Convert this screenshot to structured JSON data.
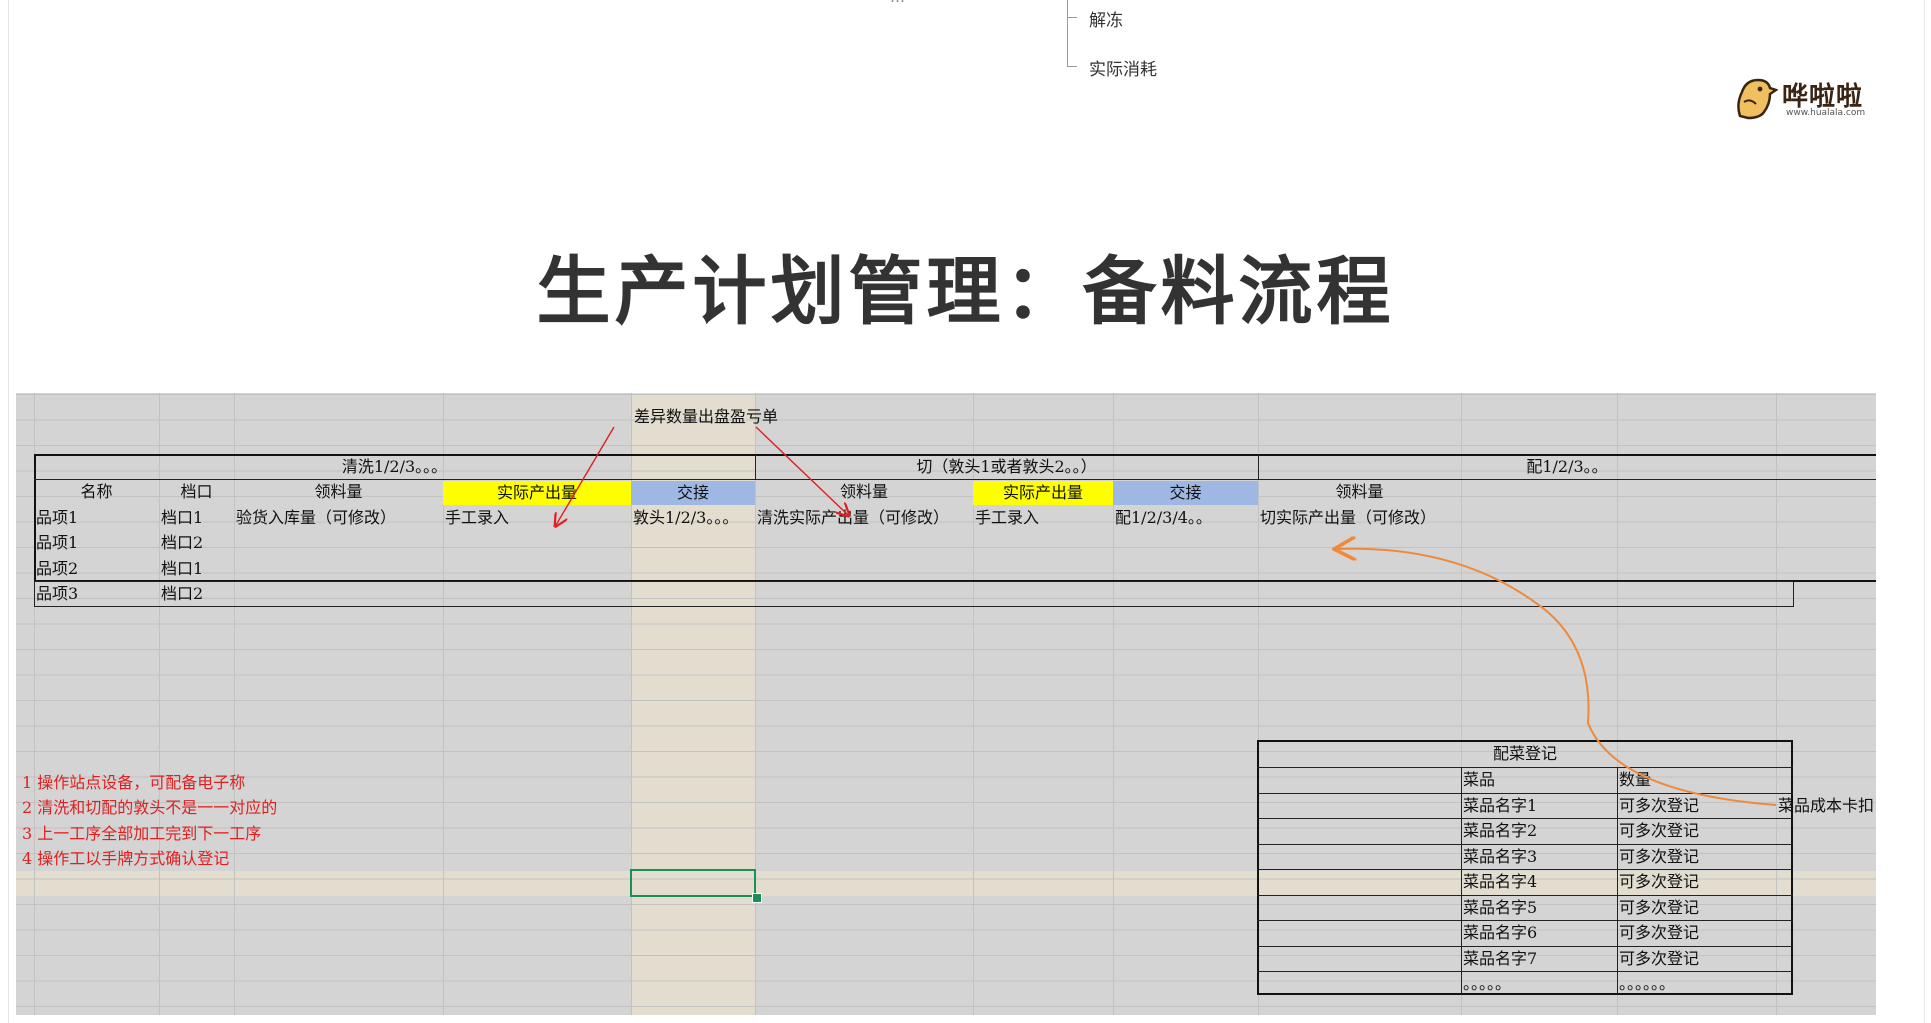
{
  "tree": {
    "cut_text": "…",
    "nodes": [
      "解冻",
      "实际消耗"
    ]
  },
  "logo": {
    "brand": "哗啦啦",
    "url": "www.hualala.com"
  },
  "title": "生产计划管理：备料流程",
  "callout": "差异数量出盘盈亏单",
  "sections": {
    "wash": "清洗1/2/3。。。",
    "cut": "切（敦头1或者敦头2。。）",
    "mix": "配1/2/3。。"
  },
  "headers": [
    "名称",
    "档口",
    "领料量",
    "实际产出量",
    "交接",
    "领料量",
    "实际产出量",
    "交接",
    "领料量"
  ],
  "row1": [
    "品项1",
    "档口1",
    "验货入库量（可修改）",
    "手工录入",
    "敦头1/2/3。。。",
    "清洗实际产出量（可修改）",
    "手工录入",
    "配1/2/3/4。。",
    "切实际产出量（可修改）"
  ],
  "rows": [
    [
      "品项1",
      "档口2"
    ],
    [
      "品项2",
      "档口1"
    ],
    [
      "品项3",
      "档口2"
    ]
  ],
  "notes": [
    "1 操作站点设备，可配备电子称",
    "2 清洗和切配的敦头不是一一对应的",
    "3 上一工序全部加工完到下一工序",
    "4 操作工以手牌方式确认登记"
  ],
  "dish_register": {
    "title": "配菜登记",
    "col_dish": "菜品",
    "col_qty": "数量",
    "items": [
      "菜品名字1",
      "菜品名字2",
      "菜品名字3",
      "菜品名字4",
      "菜品名字5",
      "菜品名字6",
      "菜品名字7"
    ],
    "qty_value": "可多次登记",
    "dish_tail": "。。。。。",
    "qty_tail": "。。。。。。"
  },
  "side_label": "菜品成本卡扣",
  "colors": {
    "yellow": "#ffff00",
    "blue": "#9fb7e3",
    "red": "#e02020",
    "orange": "#ef8a3a",
    "select": "#1a8f5a"
  }
}
